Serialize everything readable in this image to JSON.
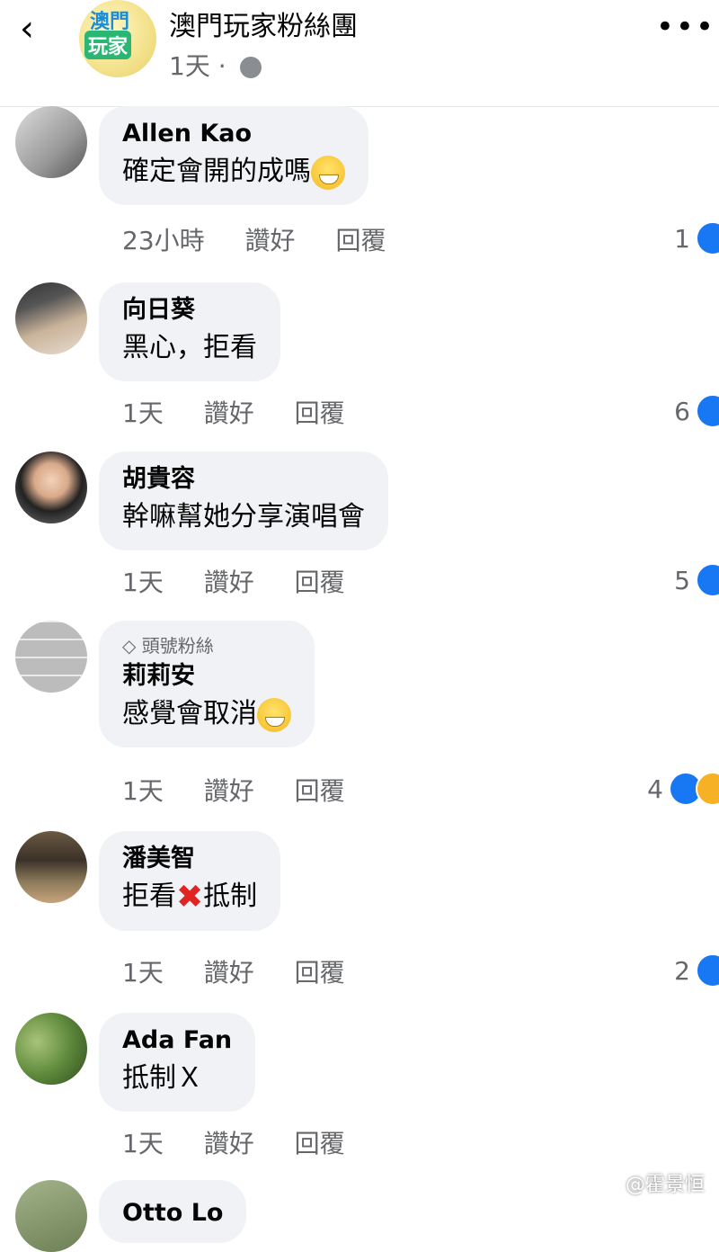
{
  "header": {
    "back_icon": "chevron-left-icon",
    "logo_line1": "澳門",
    "logo_line2": "玩家",
    "group_name": "澳門玩家粉絲團",
    "time": "1天",
    "separator": "·",
    "privacy_icon": "globe-icon",
    "more_icon": "more-horizontal-icon",
    "more_glyph": "•••"
  },
  "comments": [
    {
      "name": "Allen Kao",
      "text": "確定會開的成嗎",
      "emoji": "grinning-sweat-emoji",
      "time": "23小時",
      "like_label": "讚好",
      "reply_label": "回覆",
      "reactions": "1"
    },
    {
      "name": "向日葵",
      "text": "黑心，拒看",
      "time": "1天",
      "like_label": "讚好",
      "reply_label": "回覆",
      "reactions": "6"
    },
    {
      "name": "胡貴容",
      "text": "幹嘛幫她分享演唱會",
      "time": "1天",
      "like_label": "讚好",
      "reply_label": "回覆",
      "reactions": "5"
    },
    {
      "badge": "頭號粉絲",
      "name": "莉莉安",
      "text": "感覺會取消",
      "emoji": "grinning-sweat-emoji",
      "time": "1天",
      "like_label": "讚好",
      "reply_label": "回覆",
      "reactions": "4"
    },
    {
      "name": "潘美智",
      "text_before": "拒看",
      "text_after": "抵制",
      "mark": "✖",
      "time": "1天",
      "like_label": "讚好",
      "reply_label": "回覆",
      "reactions": "2"
    },
    {
      "name": "Ada Fan",
      "text": "抵制Ｘ",
      "time": "1天",
      "like_label": "讚好",
      "reply_label": "回覆"
    },
    {
      "name": "Otto Lo"
    }
  ],
  "watermark": "@霍景恒",
  "colors": {
    "like_blue": "#1877f2",
    "bubble": "#f0f2f5",
    "secondary_text": "#65676b"
  }
}
